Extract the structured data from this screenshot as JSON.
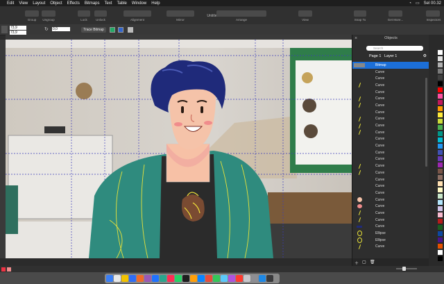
{
  "menubar": {
    "apple": "",
    "items": [
      "Edit",
      "View",
      "Layout",
      "Object",
      "Effects",
      "Bitmaps",
      "Text",
      "Table",
      "Window",
      "Help"
    ],
    "status": {
      "clock": "Sel 00.32"
    }
  },
  "document": {
    "title": "Untitled-1 — Edited"
  },
  "toolbar": {
    "groups": [
      "Group",
      "Ungroup",
      "Lock",
      "Unlock",
      "Alignment",
      "Mirror",
      "Arrange",
      "View",
      "Snap To",
      "Get More...",
      "Inspectors"
    ]
  },
  "properties": {
    "x_value": "73,9",
    "y_value": "73,9",
    "angle_value": "0,0",
    "trace_bitmap_label": "Trace Bitmap"
  },
  "objects_panel": {
    "title": "Objects",
    "search_placeholder": "Search",
    "page_label": "Page 1",
    "layer_label": "Layer 1",
    "rows": [
      {
        "label": "Bitmap",
        "thumb": "bitmap",
        "selected": true
      },
      {
        "label": "Curve",
        "thumb": "none"
      },
      {
        "label": "Curve",
        "thumb": "none"
      },
      {
        "label": "Curve",
        "thumb": "stroke"
      },
      {
        "label": "Curve",
        "thumb": "none"
      },
      {
        "label": "Curve",
        "thumb": "stroke"
      },
      {
        "label": "Curve",
        "thumb": "stroke"
      },
      {
        "label": "Curve",
        "thumb": "none"
      },
      {
        "label": "Curve",
        "thumb": "stroke"
      },
      {
        "label": "Curve",
        "thumb": "stroke"
      },
      {
        "label": "Curve",
        "thumb": "stroke"
      },
      {
        "label": "Curve",
        "thumb": "none"
      },
      {
        "label": "Curve",
        "thumb": "none"
      },
      {
        "label": "Curve",
        "thumb": "none"
      },
      {
        "label": "Curve",
        "thumb": "none"
      },
      {
        "label": "Curve",
        "thumb": "stroke"
      },
      {
        "label": "Curve",
        "thumb": "stroke"
      },
      {
        "label": "Curve",
        "thumb": "none"
      },
      {
        "label": "Curve",
        "thumb": "none"
      },
      {
        "label": "Curve",
        "thumb": "none"
      },
      {
        "label": "Curve",
        "thumb": "skin"
      },
      {
        "label": "Curve",
        "thumb": "pink"
      },
      {
        "label": "Curve",
        "thumb": "stroke"
      },
      {
        "label": "Curve",
        "thumb": "stroke"
      },
      {
        "label": "Curve",
        "thumb": "navy"
      },
      {
        "label": "Ellipse",
        "thumb": "ellipse"
      },
      {
        "label": "Ellipse",
        "thumb": "ellipse"
      },
      {
        "label": "Curve",
        "thumb": "stroke"
      }
    ]
  },
  "palette": {
    "colors": [
      "#ffffff",
      "#e0e0e0",
      "#b0b0b0",
      "#7a7a7a",
      "#404040",
      "#000000",
      "#ff0000",
      "#ff4fa0",
      "#c2185b",
      "#ff9800",
      "#ffeb3b",
      "#cddc39",
      "#4caf50",
      "#009688",
      "#00bcd4",
      "#2196f3",
      "#3f51b5",
      "#673ab7",
      "#9c27b0",
      "#795548",
      "#8d6e63",
      "#ffe0b2",
      "#fff9c4",
      "#c8e6c9",
      "#b3e5fc",
      "#d1c4e9",
      "#f8bbd0",
      "#b71c1c",
      "#1b5e20",
      "#0d47a1",
      "#4a148c",
      "#e65100",
      "#ffffff",
      "#000000"
    ]
  },
  "dock": {
    "icons": [
      "#3a7ff6",
      "#e8e8e8",
      "#f2c200",
      "#2f6df6",
      "#f06a2a",
      "#9b59b6",
      "#1f73ff",
      "#2ca58d",
      "#ff2d55",
      "#25d366",
      "#1e1e1e",
      "#ff9f0a",
      "#0a84ff",
      "#e74c3c",
      "#34c759",
      "#5ac8fa",
      "#af52de",
      "#ff3b30",
      "#c7c7cc",
      "#8e8e93",
      "#1e88e5",
      "#3a3a3c"
    ]
  }
}
